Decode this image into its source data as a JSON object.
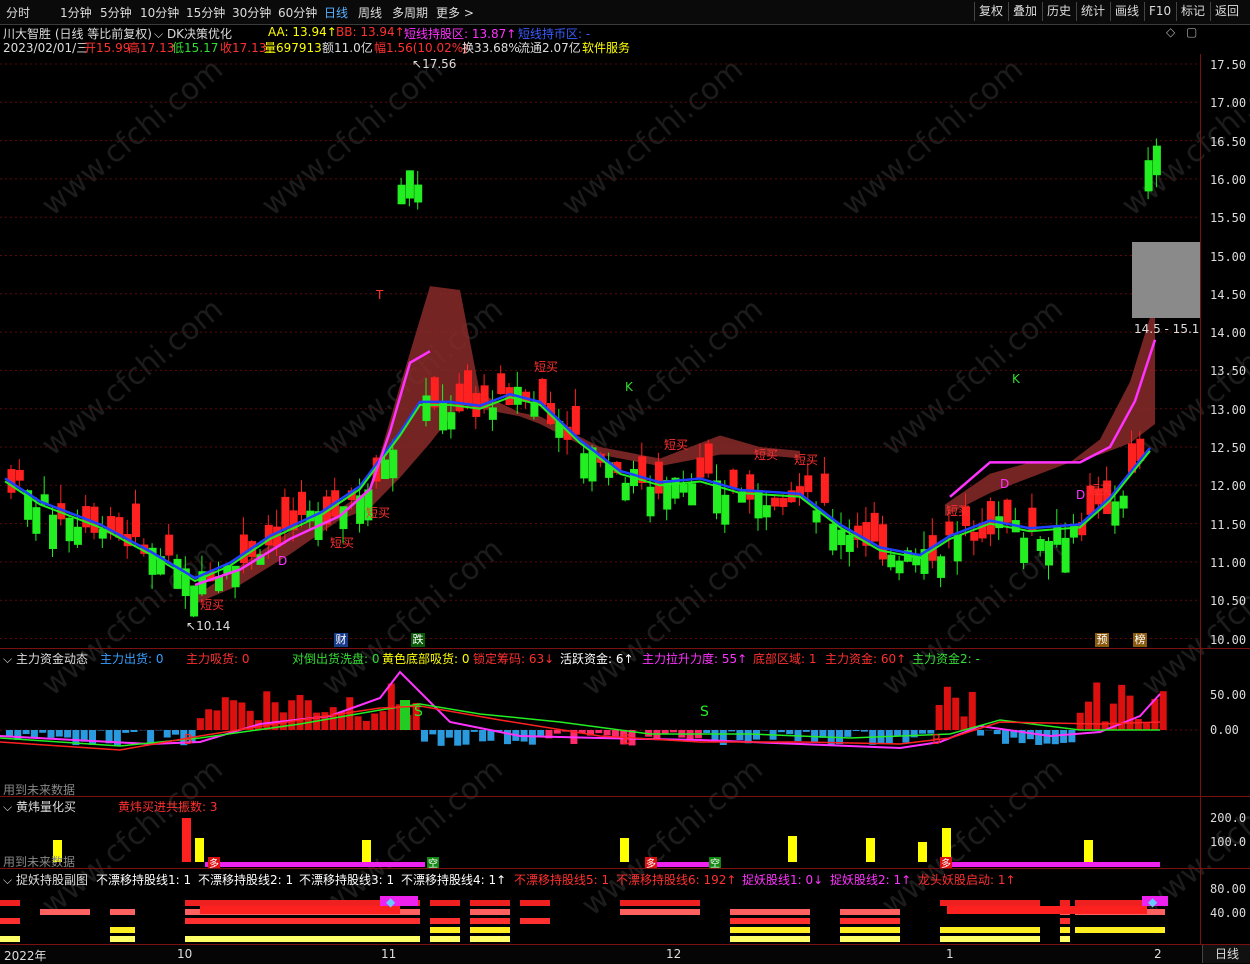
{
  "toolbar": {
    "periods": [
      "分时",
      "1分钟",
      "5分钟",
      "10分钟",
      "15分钟",
      "30分钟",
      "60分钟",
      "日线",
      "周线",
      "多周期",
      "更多 >"
    ],
    "active_period": "日线",
    "right_buttons": [
      "复权",
      "叠加",
      "历史",
      "统计",
      "画线",
      "F10",
      "标记",
      "返回"
    ]
  },
  "header": {
    "stock_name": "川大智胜 (日线 等比前复权)",
    "indicator_name": "DK决策优化",
    "aa": "AA: 13.94↑",
    "bb": "BB: 13.94↑",
    "hold_zone": "短线持股区: 13.87↑",
    "coin_zone": "短线持币区: -",
    "date": "2023/02/01/三",
    "open": "开15.99",
    "high": "高17.13",
    "low": "低15.17",
    "close": "收17.13",
    "volume": "量697913",
    "amount": "额11.0亿",
    "change": "幅1.56(10.02%)",
    "turnover": "换33.68%",
    "float": "流通2.07亿",
    "sector": "软件服务"
  },
  "main_chart": {
    "y_ticks": [
      "17.50",
      "17.00",
      "16.50",
      "16.00",
      "15.50",
      "15.00",
      "14.50",
      "14.00",
      "13.50",
      "13.00",
      "12.50",
      "12.00",
      "11.50",
      "11.00",
      "10.50",
      "10.00"
    ],
    "high_label": "17.56",
    "low_label": "10.14",
    "range_label": "14.5 - 15.1",
    "signal_buy": "短买",
    "signal_k": "K",
    "signal_d": "D",
    "signal_t": "T",
    "marker_cai": "财",
    "marker_die": "跌",
    "marker_yu": "预",
    "marker_bang": "榜"
  },
  "chart_data": {
    "type": "candlestick",
    "ylim": [
      9.9,
      17.8
    ],
    "y_ticks": [
      17.5,
      17.0,
      16.5,
      16.0,
      15.5,
      15.0,
      14.5,
      14.0,
      13.5,
      13.0,
      12.5,
      12.0,
      11.5,
      11.0,
      10.5,
      10.0
    ],
    "last_bar": {
      "open": 15.99,
      "high": 17.13,
      "low": 15.17,
      "close": 17.13
    },
    "high_extreme": 17.56,
    "low_extreme": 10.14
  },
  "panel1": {
    "title": "主力资金动态",
    "labels": [
      {
        "text": "主力出货: 0",
        "color": "#3aa0ff"
      },
      {
        "text": "主力吸货: 0",
        "color": "#ff3030"
      },
      {
        "text": "对倒出货洗盘: 0",
        "color": "#33dd33"
      },
      {
        "text": "黄色底部吸货: 0",
        "color": "#ffff00"
      },
      {
        "text": "锁定筹码: 63↓",
        "color": "#ff3030"
      },
      {
        "text": "活跃资金: 6↑",
        "color": "#ffffff"
      },
      {
        "text": "主力拉升力度: 55↑",
        "color": "#ff33ff"
      },
      {
        "text": "底部区域: 1",
        "color": "#ff3030"
      },
      {
        "text": "主力资金: 60↑",
        "color": "#ff3030"
      },
      {
        "text": "主力资金2: -",
        "color": "#33dd33"
      }
    ],
    "y_ticks": [
      "50.00",
      "0.00"
    ],
    "note": "用到未来数据",
    "s_label": "S",
    "b_label": "B"
  },
  "panel2": {
    "title": "黄炜量化买",
    "label": "黄炜买进共振数: 3",
    "y_ticks": [
      "200.0",
      "100.0"
    ],
    "note": "用到未来数据",
    "duo": "多",
    "kong": "空"
  },
  "panel3": {
    "title": "捉妖持股副图",
    "labels": [
      {
        "text": "不漂移持股线1: 1",
        "color": "#ffffff"
      },
      {
        "text": "不漂移持股线2: 1",
        "color": "#ffffff"
      },
      {
        "text": "不漂移持股线3: 1",
        "color": "#ffffff"
      },
      {
        "text": "不漂移持股线4: 1↑",
        "color": "#ffffff"
      },
      {
        "text": "不漂移持股线5: 1",
        "color": "#ff3030"
      },
      {
        "text": "不漂移持股线6: 192↑",
        "color": "#ff3030"
      },
      {
        "text": "捉妖股线1: 0↓",
        "color": "#ff33ff"
      },
      {
        "text": "捉妖股线2: 1↑",
        "color": "#ff33ff"
      },
      {
        "text": "龙头妖股启动: 1↑",
        "color": "#ff3030"
      }
    ],
    "y_ticks": [
      "80.00",
      "40.00"
    ]
  },
  "timeline": {
    "labels": [
      "2022年",
      "10",
      "11",
      "12",
      "1",
      "2"
    ],
    "right_label": "日线"
  },
  "watermark": "www.cfchi.com"
}
